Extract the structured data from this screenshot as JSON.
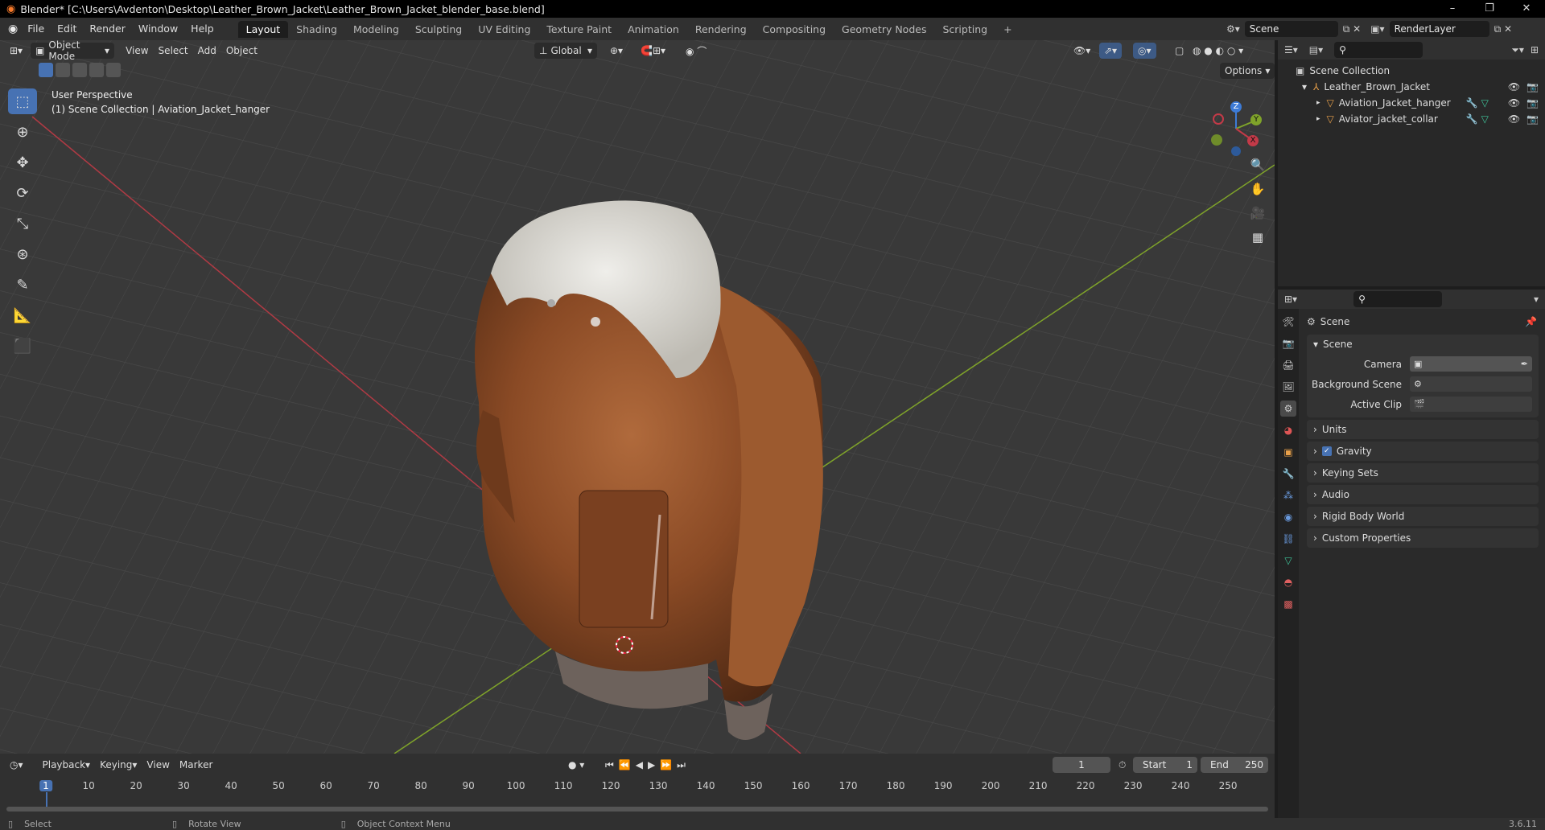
{
  "titlebar": {
    "title": "Blender* [C:\\Users\\Avdenton\\Desktop\\Leather_Brown_Jacket\\Leather_Brown_Jacket_blender_base.blend]",
    "min": "–",
    "max": "❐",
    "close": "✕"
  },
  "menu": [
    "File",
    "Edit",
    "Render",
    "Window",
    "Help"
  ],
  "workspaces": [
    {
      "label": "Layout",
      "active": true
    },
    {
      "label": "Shading"
    },
    {
      "label": "Modeling"
    },
    {
      "label": "Sculpting"
    },
    {
      "label": "UV Editing"
    },
    {
      "label": "Texture Paint"
    },
    {
      "label": "Animation"
    },
    {
      "label": "Rendering"
    },
    {
      "label": "Compositing"
    },
    {
      "label": "Geometry Nodes"
    },
    {
      "label": "Scripting"
    }
  ],
  "add_workspace": "+",
  "scene_selector": "Scene",
  "view_layer": "RenderLayer",
  "viewport": {
    "mode": "Object Mode",
    "menus": [
      "View",
      "Select",
      "Add",
      "Object"
    ],
    "transform_orientation": "Global",
    "options": "Options",
    "info_line1": "User Perspective",
    "info_line2": "(1) Scene Collection | Aviation_Jacket_hanger"
  },
  "gizmo": {
    "z": "Z",
    "y": "Y",
    "x": "X"
  },
  "outliner": {
    "root": "Scene Collection",
    "collection": "Leather_Brown_Jacket",
    "items": [
      "Aviation_Jacket_hanger",
      "Aviator_jacket_collar"
    ]
  },
  "properties": {
    "context": "Scene",
    "panel": "Scene",
    "fields": [
      {
        "label": "Camera"
      },
      {
        "label": "Background Scene"
      },
      {
        "label": "Active Clip"
      }
    ],
    "collapsed": [
      "Units",
      "Gravity",
      "Keying Sets",
      "Audio",
      "Rigid Body World",
      "Custom Properties"
    ]
  },
  "timeline": {
    "menus": [
      "Playback",
      "Keying",
      "View",
      "Marker"
    ],
    "current_frame": "1",
    "start_label": "Start",
    "start": "1",
    "end_label": "End",
    "end": "250",
    "ruler": [
      "1",
      "10",
      "20",
      "30",
      "40",
      "50",
      "60",
      "70",
      "80",
      "90",
      "100",
      "110",
      "120",
      "130",
      "140",
      "150",
      "160",
      "170",
      "180",
      "190",
      "200",
      "210",
      "220",
      "230",
      "240",
      "250"
    ]
  },
  "statusbar": {
    "select": "Select",
    "rotate": "Rotate View",
    "context_menu": "Object Context Menu",
    "version": "3.6.11"
  },
  "colors": {
    "accent": "#4772b3",
    "x_axis": "#c33a48",
    "y_axis": "#7fa32a",
    "z_axis": "#3d7bd6"
  }
}
